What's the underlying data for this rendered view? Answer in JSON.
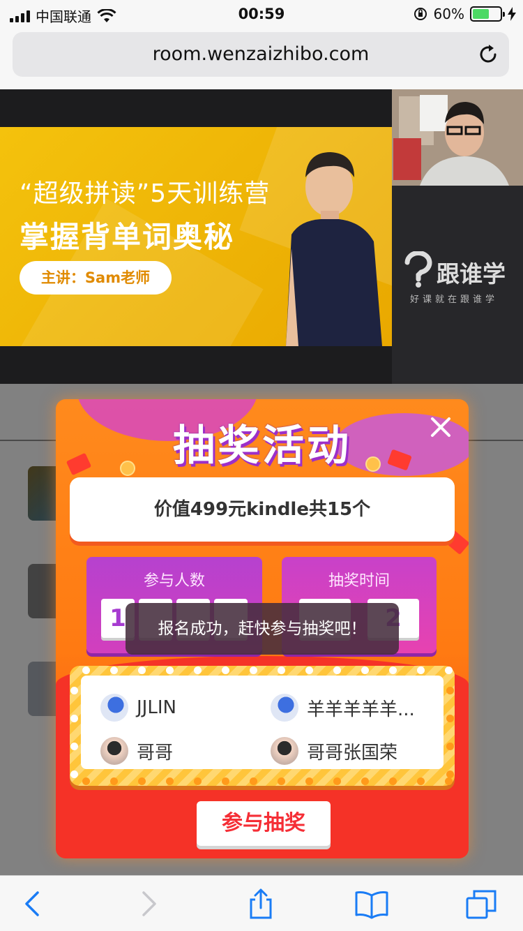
{
  "status_bar": {
    "carrier": "中国联通",
    "time": "00:59",
    "battery_text": "60%",
    "battery_level": 0.6,
    "icons": [
      "signal-icon",
      "wifi-icon",
      "orientation-lock-icon",
      "battery-icon",
      "charging-icon"
    ]
  },
  "address_bar": {
    "url": "room.wenzaizhibo.com",
    "reload_icon": "reload-icon"
  },
  "video": {
    "banner_subtitle": "“超级拼读”5天训练营",
    "banner_title": "掌握背单词奥秘",
    "banner_teacher": "主讲：Sam老师",
    "logo_text": "跟谁学",
    "logo_tagline": "好课就在跟谁学"
  },
  "lottery": {
    "title": "抽奖活动",
    "prize": "价值499元kindle共15个",
    "participants_label": "参与人数",
    "participants_digits": [
      "1",
      "",
      "",
      ""
    ],
    "draw_time_label": "抽奖时间",
    "draw_time_digits": [
      "",
      "2"
    ],
    "participants": [
      {
        "name": "JJLIN",
        "avatar": "a1"
      },
      {
        "name": "羊羊羊羊羊...",
        "avatar": "a1"
      },
      {
        "name": "哥哥",
        "avatar": "a2"
      },
      {
        "name": "哥哥张国荣",
        "avatar": "a2"
      }
    ],
    "join_button": "参与抽奖",
    "close_icon": "close-icon"
  },
  "toast": {
    "message": "报名成功，赶快参与抽奖吧！"
  },
  "toolbar": {
    "icons": [
      "back-icon",
      "forward-icon",
      "share-icon",
      "bookmarks-icon",
      "tabs-icon"
    ]
  },
  "colors": {
    "modal_orange": "#ff8a1d",
    "modal_red": "#f53227",
    "stat_purple": "#b641cf",
    "title_shadow": "#9c2fc9",
    "join_text": "#f52e36",
    "ios_blue": "#1a7cf5"
  }
}
